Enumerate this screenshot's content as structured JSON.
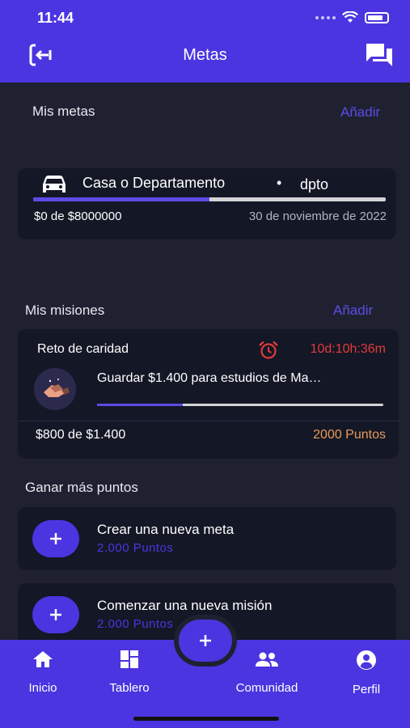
{
  "status_bar": {
    "time": "11:44"
  },
  "header": {
    "title": "Metas"
  },
  "goals": {
    "section_title": "Mis metas",
    "add_label": "Añadir",
    "item": {
      "name": "Casa o Departamento",
      "bullet": "•",
      "tag": "dpto",
      "amount": "$0 de $8000000",
      "date": "30 de noviembre de 2022",
      "progress": 0.5
    }
  },
  "missions": {
    "section_title": "Mis misiones",
    "add_label": "Añadir",
    "item": {
      "type": "Reto de caridad",
      "timer": "10d:10h:36m",
      "title": "Guardar $1.400 para estudios de Ma…",
      "amount": "$800 de $1.400",
      "points": "2000 Puntos",
      "progress": 0.3
    }
  },
  "earn": {
    "section_title": "Ganar más puntos",
    "items": [
      {
        "title": "Crear una nueva meta",
        "points": "2.000 Puntos"
      },
      {
        "title": "Comenzar una nueva misión",
        "points": "2.000 Puntos"
      }
    ]
  },
  "tabbar": {
    "items": [
      {
        "label": "Inicio",
        "icon": "home-icon"
      },
      {
        "label": "Tablero",
        "icon": "dashboard-icon"
      },
      {
        "label": "Comunidad",
        "icon": "people-icon"
      },
      {
        "label": "Perfil",
        "icon": "profile-icon"
      }
    ]
  },
  "colors": {
    "accent": "#4b35e0",
    "background": "#1f2130",
    "card": "#141726",
    "timer": "#e23a3a",
    "points": "#e89a5a"
  }
}
